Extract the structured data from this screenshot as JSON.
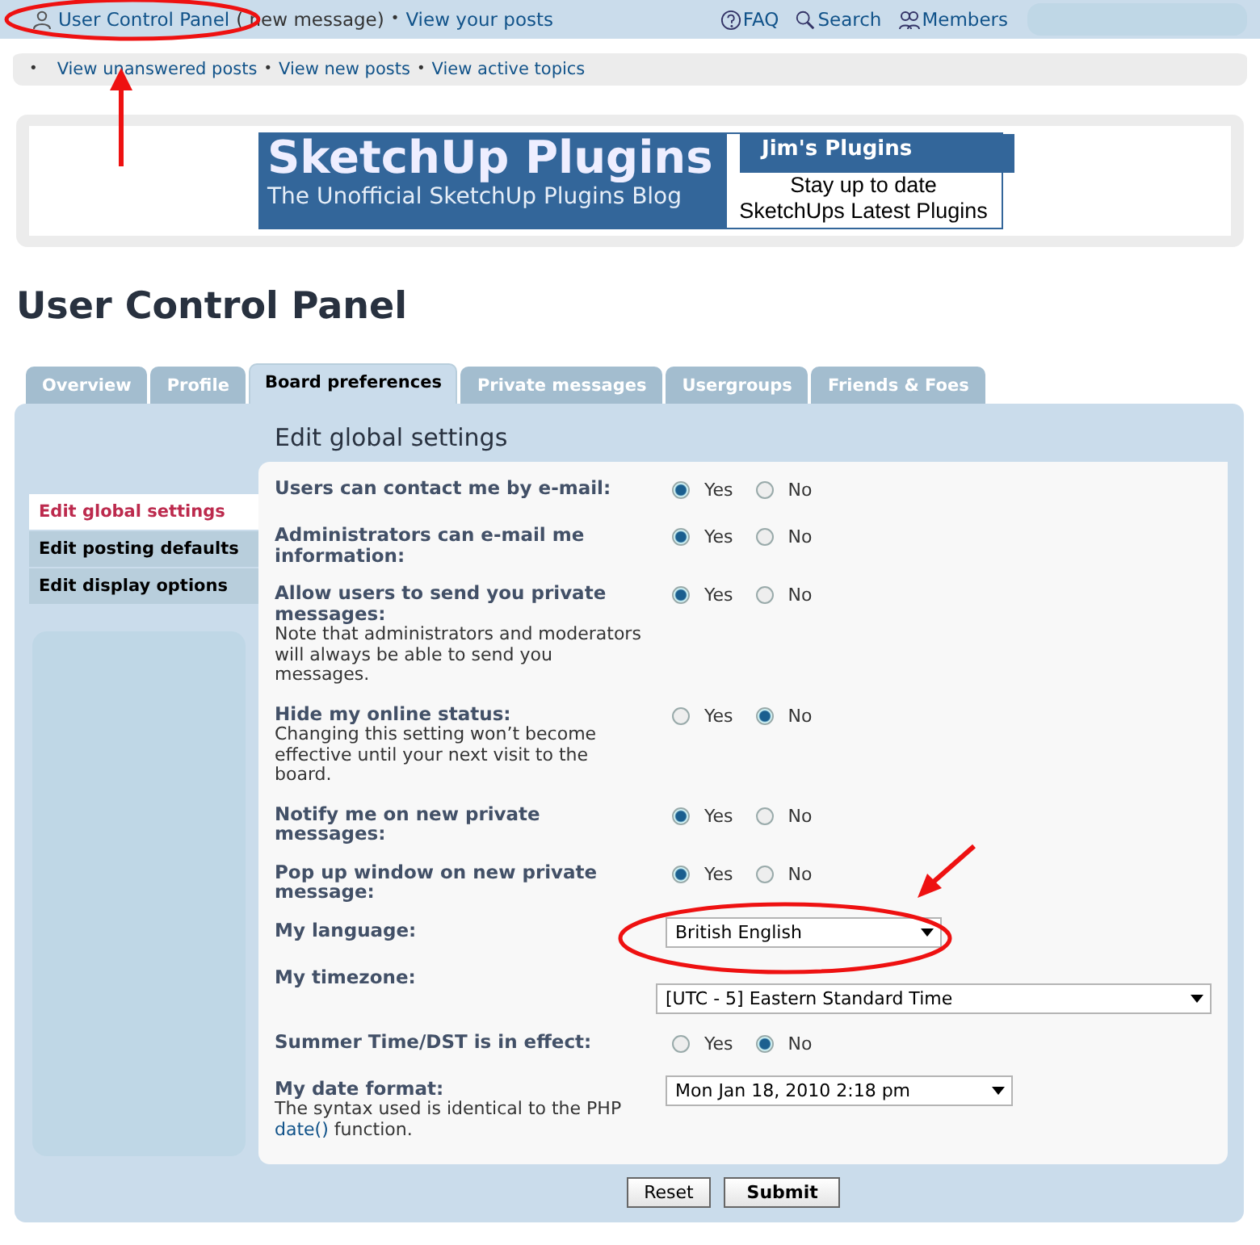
{
  "header": {
    "ucp_link": "User Control Panel",
    "messages_text": "( new message)",
    "separator": "•",
    "posts_link": "View your posts",
    "links": [
      {
        "kind": "faq",
        "label": "FAQ"
      },
      {
        "kind": "search",
        "label": "Search"
      },
      {
        "kind": "members",
        "label": "Members"
      }
    ]
  },
  "quick_links": [
    {
      "bullet": "•",
      "label": "View unanswered posts"
    },
    {
      "bullet": "•",
      "label": "View new posts"
    },
    {
      "bullet": "•",
      "label": "View active topics"
    }
  ],
  "banner": {
    "title": "SketchUp Plugins",
    "subtitle": "The Unofficial SketchUp Plugins Blog",
    "side_title": "Jim's Plugins",
    "side_lines": [
      "Stay up to date",
      "SketchUps Latest Plugins"
    ]
  },
  "page_title": "User Control Panel",
  "tabs": [
    {
      "label": "Overview",
      "selected": false
    },
    {
      "label": "Profile",
      "selected": false
    },
    {
      "label": "Board preferences",
      "selected": true
    },
    {
      "label": "Private messages",
      "selected": false
    },
    {
      "label": "Usergroups",
      "selected": false
    },
    {
      "label": "Friends & Foes",
      "selected": false
    }
  ],
  "sidebar": [
    {
      "label": "Edit global settings",
      "selected": true
    },
    {
      "label": "Edit posting defaults",
      "selected": false
    },
    {
      "label": "Edit display options",
      "selected": false
    }
  ],
  "section_title": "Edit global settings",
  "settings": [
    {
      "kind": "radio",
      "label": "Users can contact me by e-mail:",
      "options": [
        {
          "label": "Yes",
          "selected": true
        },
        {
          "label": "No",
          "selected": false
        }
      ]
    },
    {
      "kind": "radio",
      "label": "Administrators can e-mail me information:",
      "options": [
        {
          "label": "Yes",
          "selected": true
        },
        {
          "label": "No",
          "selected": false
        }
      ]
    },
    {
      "kind": "radio",
      "label": "Allow users to send you private messages:",
      "note": "Note that administrators and moderators will always be able to send you messages.",
      "options": [
        {
          "label": "Yes",
          "selected": true
        },
        {
          "label": "No",
          "selected": false
        }
      ]
    },
    {
      "kind": "radio",
      "label": "Hide my online status:",
      "note": "Changing this setting won’t become effective until your next visit to the board.",
      "options": [
        {
          "label": "Yes",
          "selected": false
        },
        {
          "label": "No",
          "selected": true
        }
      ]
    },
    {
      "kind": "radio",
      "label": "Notify me on new private messages:",
      "options": [
        {
          "label": "Yes",
          "selected": true
        },
        {
          "label": "No",
          "selected": false
        }
      ]
    },
    {
      "kind": "radio",
      "label": "Pop up window on new private message:",
      "options": [
        {
          "label": "Yes",
          "selected": true
        },
        {
          "label": "No",
          "selected": false
        }
      ]
    },
    {
      "kind": "select",
      "label": "My language:",
      "value": "British English",
      "full_width": false
    },
    {
      "kind": "select",
      "label": "My timezone:",
      "value": "[UTC - 5] Eastern Standard Time",
      "full_width": true
    },
    {
      "kind": "radio",
      "label": "Summer Time/DST is in effect:",
      "options": [
        {
          "label": "Yes",
          "selected": false
        },
        {
          "label": "No",
          "selected": true
        }
      ]
    },
    {
      "kind": "select",
      "label": "My date format:",
      "note": "The syntax used is identical to the PHP",
      "note_link": "date()",
      "note_after": "function.",
      "value": "Mon Jan 18, 2010 2:18 pm",
      "full_width": false
    }
  ],
  "buttons": [
    {
      "kind": "reset",
      "label": "Reset"
    },
    {
      "kind": "submit",
      "label": "Submit"
    }
  ]
}
